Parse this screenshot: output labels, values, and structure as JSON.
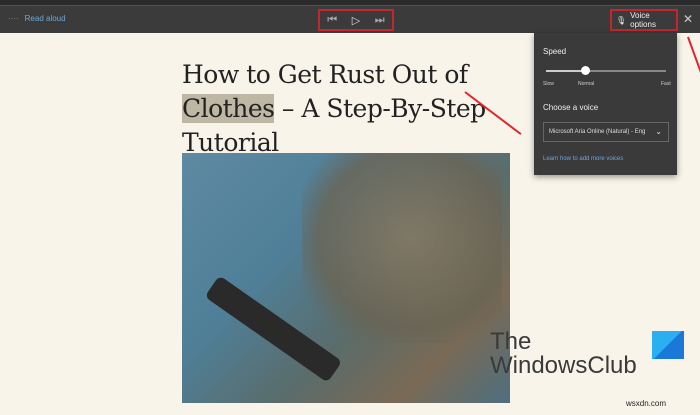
{
  "toolbar": {
    "read_aloud": "Read aloud",
    "dots": "····",
    "prev": "⏮",
    "play": "▷",
    "next": "⏭",
    "voice_options": "Voice options",
    "close": "✕"
  },
  "voice_panel": {
    "speed_label": "Speed",
    "speed_value": "Normal",
    "speed_fraction": 0.33,
    "slow": "Slow",
    "normal": "Normal",
    "fast": "Fast",
    "choose_voice": "Choose a voice",
    "voice_selected": "Microsoft Aria Online (Natural) - Eng",
    "learn_link": "Learn how to add more voices"
  },
  "article": {
    "title_before": "How to Get Rust Out of ",
    "title_highlight": "Clothes",
    "title_after": " – A Step-By-Step Tutorial"
  },
  "watermark": {
    "logo_line1": "The",
    "logo_line2": "WindowsClub",
    "site": "wsxdn.com"
  },
  "colors": {
    "toolbar": "#3b3b3b",
    "highlight_box": "#c1272d",
    "link": "#6fa6d8",
    "page": "#f8f4e9"
  }
}
